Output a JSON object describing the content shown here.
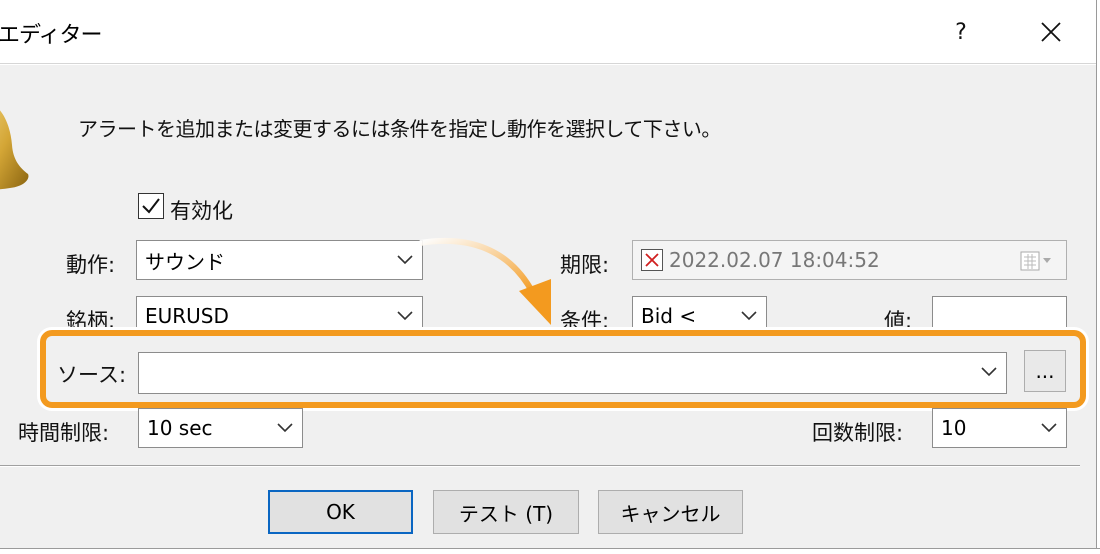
{
  "window": {
    "title": "エディター",
    "help_label": "?",
    "close_label": "✕"
  },
  "instructions": "アラートを追加または変更するには条件を指定し動作を選択して下さい。",
  "enabled": {
    "label": "有効化",
    "checked": true
  },
  "action": {
    "label": "動作:",
    "value": "サウンド"
  },
  "expiry": {
    "label": "期限:",
    "value": "2022.02.07 18:04:52"
  },
  "symbol": {
    "label": "銘柄:",
    "value": "EURUSD"
  },
  "condition": {
    "label": "条件:",
    "value": "Bid <"
  },
  "value_field": {
    "label": "値:",
    "value": ""
  },
  "source": {
    "label": "ソース:",
    "value": "",
    "browse_label": "..."
  },
  "timeout": {
    "label": "時間制限:",
    "value": "10 sec"
  },
  "max_iterations": {
    "label": "回数制限:",
    "value": "10"
  },
  "buttons": {
    "ok": "OK",
    "test": "テスト (T)",
    "cancel": "キャンセル"
  },
  "colors": {
    "highlight": "#f39a1f",
    "default_button_border": "#0a66c2",
    "dialog_bg": "#f0f0f0"
  },
  "icons": [
    "bell-icon",
    "checkbox-checked-icon",
    "chevron-down-icon",
    "calendar-icon",
    "x-mark-icon",
    "curved-arrow-icon",
    "close-icon"
  ]
}
